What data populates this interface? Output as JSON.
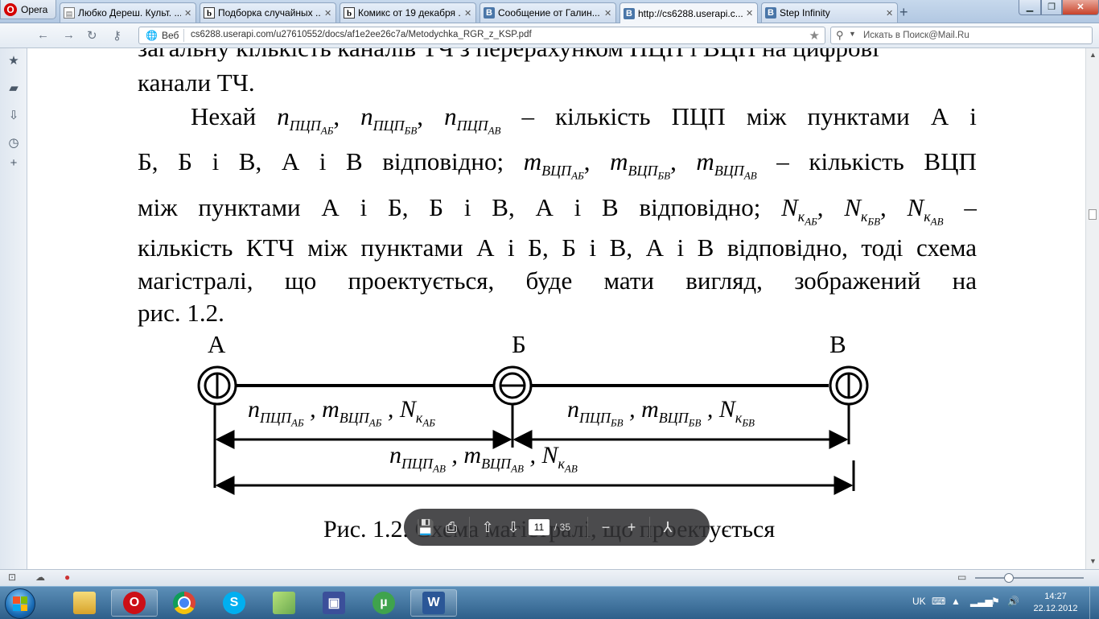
{
  "browser": {
    "menu_label": "Opera",
    "tabs": [
      {
        "label": "Любко Дереш. Культ. ...",
        "favicon": "document-icon"
      },
      {
        "label": "Подборка случайных ...",
        "favicon": "b-icon"
      },
      {
        "label": "Комикс от 19 декабря ...",
        "favicon": "b-icon"
      },
      {
        "label": "Сообщение от Галин...",
        "favicon": "vk-icon"
      },
      {
        "label": "http://cs6288.userapi.c...",
        "favicon": "vk-icon"
      },
      {
        "label": "Step Infinity",
        "favicon": "vk-icon"
      }
    ],
    "new_tab": "+",
    "address": {
      "prefix": "Веб",
      "url": "cs6288.userapi.com/u27610552/docs/af1e2ee26c7a/Metodychka_RGR_z_KSP.pdf"
    },
    "search": {
      "placeholder": "Искать в Поиск@Mail.Ru"
    }
  },
  "document": {
    "line1": "загальну кількість каналів ТЧ з перерахунком ПЦП і ВЦП на цифрові",
    "line2": "канали ТЧ.",
    "para_lines": [
      "Нехай n_ПЦП_АБ , n_ПЦП_БВ , n_ПЦП_АВ – кількість ПЦП між пунктами А і",
      "Б, Б і В, А і В відповідно; m_ВЦП_АБ , m_ВЦП_БВ , m_ВЦП_АВ – кількість ВЦП",
      "між пунктами А і Б, Б і В, А і В відповідно; N_к_АБ , N_к_БВ , N_к_АВ –",
      "кількість КТЧ між пунктами А і Б, Б і В, А і В відповідно, тоді схема",
      "магістралі, що проектується, буде мати вигляд, зображений на",
      "рис. 1.2."
    ],
    "w": {
      "nehai": "Нехай",
      "dash": "–",
      "comma": ",",
      "kilkist": "кількість",
      "pcp": "ПЦП",
      "vcp": "ВЦП",
      "mizh": "між",
      "punktamy": "пунктами",
      "a": "А",
      "i": "і",
      "b": "Б",
      "v": "В",
      "b_semi": "Б,",
      "v_comma": "В,",
      "vidpovidno_semi": "відповідно;",
      "line6": "кількість КТЧ між пунктами А і Б, Б і В, А і В відповідно, тоді схема",
      "magistrali": "магістралі,",
      "scho": "що",
      "proektuetsia": "проектується,",
      "bude": "буде",
      "maty": "мати",
      "vygliad": "вигляд,",
      "zobrazhenyi": "зображений",
      "na": "на",
      "line8": "рис. 1.2."
    },
    "sym": {
      "n": "n",
      "m": "m",
      "N": "N",
      "PCP": "ПЦП",
      "VCP": "ВЦП",
      "k": "к",
      "AB": "АБ",
      "BV": "БВ",
      "AV": "АВ"
    },
    "diagram": {
      "points": [
        "А",
        "Б",
        "В"
      ],
      "label_ab": "n_ПЦП_АБ , m_ВЦП_АБ , N_к_АБ",
      "label_bv": "n_ПЦП_БВ , m_ВЦП_БВ , N_к_БВ",
      "label_av": "n_ПЦП_АВ , m_ВЦП_АВ , N_к_АВ"
    },
    "caption": "Рис. 1.2. Схема магістралі, що проектується"
  },
  "pdf_toolbar": {
    "page": "11",
    "of_total": "/ 35"
  },
  "taskbar": {
    "tray_lang": "UK",
    "time": "14:27",
    "date": "22.12.2012"
  }
}
